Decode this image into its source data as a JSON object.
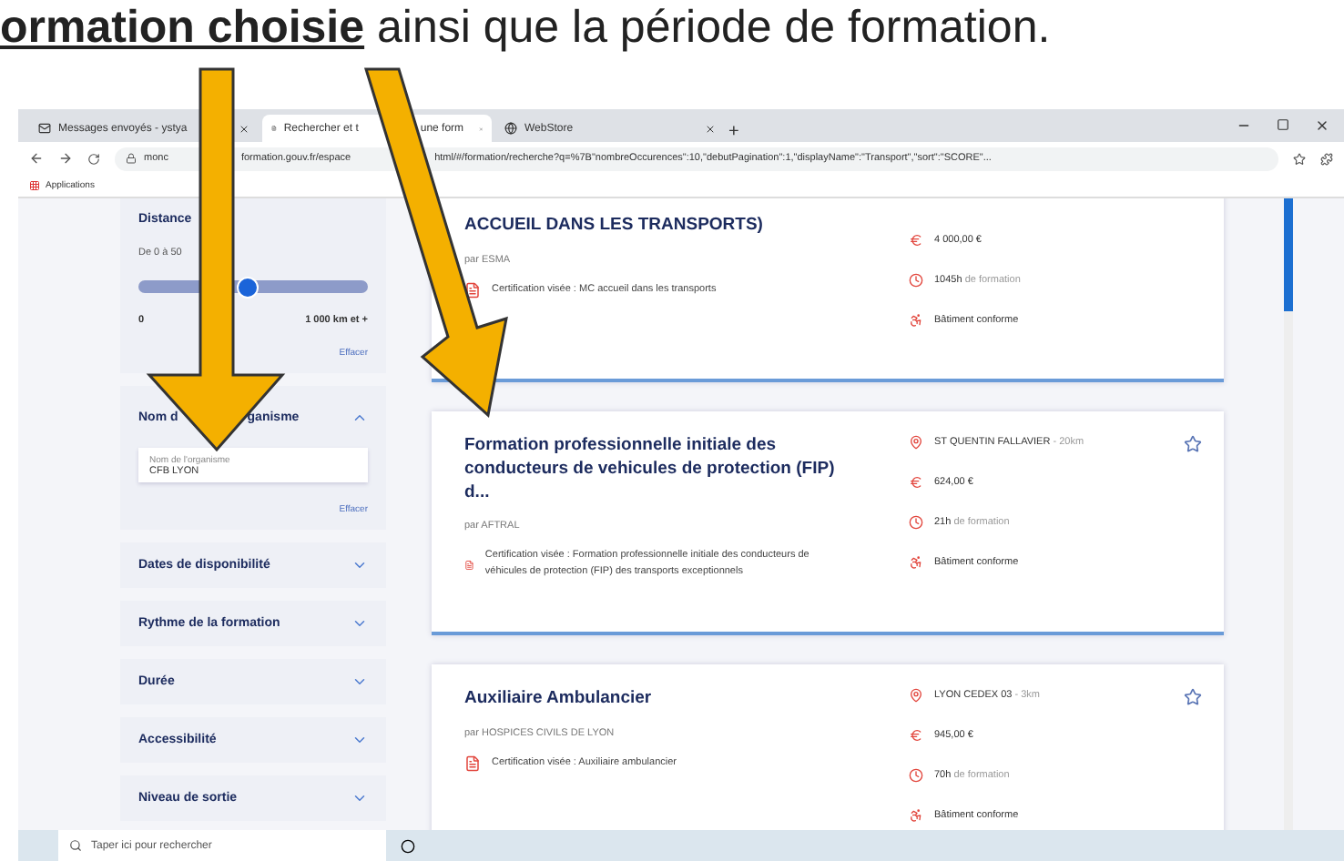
{
  "caption": "**ormation choisie** ainsi que la période de formation.",
  "browser": {
    "tabs": [
      {
        "label": [
          "Messages envoyés - ystya"
        ],
        "selected": false
      },
      {
        "label": [
          "Rechercher et t",
          "une form"
        ],
        "selected": true
      },
      {
        "label": [
          "WebStore"
        ],
        "selected": false
      }
    ],
    "new_tab": "+",
    "url": [
      "monc",
      "formation.gouv.fr/espace",
      "html/#/formation/recherche?q=%7B\"nombreOccurences\":10,\"debutPagination\":1,\"displayName\":\"Transport\",\"sort\":\"SCORE\"..."
    ],
    "bookmarks": [
      "Applications"
    ]
  },
  "filters": [
    {
      "kind": "range",
      "title": [
        "Distance"
      ],
      "subtitle": "De 0 à 50",
      "level": 0.48,
      "min": "0",
      "max": "1 000 km et +",
      "clear": "Effacer"
    },
    {
      "kind": "text",
      "title": [
        "Nom d",
        "ganisme"
      ],
      "expanded": true,
      "field_label": "Nom de l'organisme",
      "value": "CFB LYON",
      "clear": "Effacer"
    },
    {
      "kind": "collapsed",
      "title": [
        "Dates de disponibilité"
      ],
      "expanded": false
    },
    {
      "kind": "collapsed",
      "title": [
        "Rythme de la formation"
      ],
      "expanded": false
    },
    {
      "kind": "collapsed",
      "title": [
        "Durée"
      ],
      "expanded": false
    },
    {
      "kind": "collapsed",
      "title": [
        "Accessibilité"
      ],
      "expanded": false
    },
    {
      "kind": "collapsed",
      "title": [
        "Niveau de sortie"
      ],
      "expanded": false
    }
  ],
  "results": [
    {
      "title": "ACCUEIL DANS LES TRANSPORTS)",
      "by": "par ESMA",
      "certification": "Certification visée : MC accueil dans les transports",
      "price": "4 000,00 €",
      "hours": "1045h",
      "hours_suffix": "de formation",
      "access": "Bâtiment conforme"
    },
    {
      "title": "Formation professionnelle initiale des conducteurs de vehicules de protection (FIP) d...",
      "by": "par AFTRAL",
      "certification": "Certification visée : Formation professionnelle initiale des conducteurs de véhicules de protection (FIP) des transports exceptionnels",
      "location": "ST QUENTIN FALLAVIER",
      "distance": "- 20km",
      "price": "624,00 €",
      "hours": "21h",
      "hours_suffix": "de formation",
      "access": "Bâtiment conforme",
      "favorite": false
    },
    {
      "title": "Auxiliaire Ambulancier",
      "by": "par HOSPICES CIVILS DE LYON",
      "certification": "Certification visée : Auxiliaire ambulancier",
      "location": "LYON CEDEX 03",
      "distance": "- 3km",
      "price": "945,00 €",
      "hours": "70h",
      "hours_suffix": "de formation",
      "access": "Bâtiment conforme",
      "favorite": false
    }
  ],
  "taskbar": {
    "search_placeholder": "Taper ici pour rechercher"
  }
}
